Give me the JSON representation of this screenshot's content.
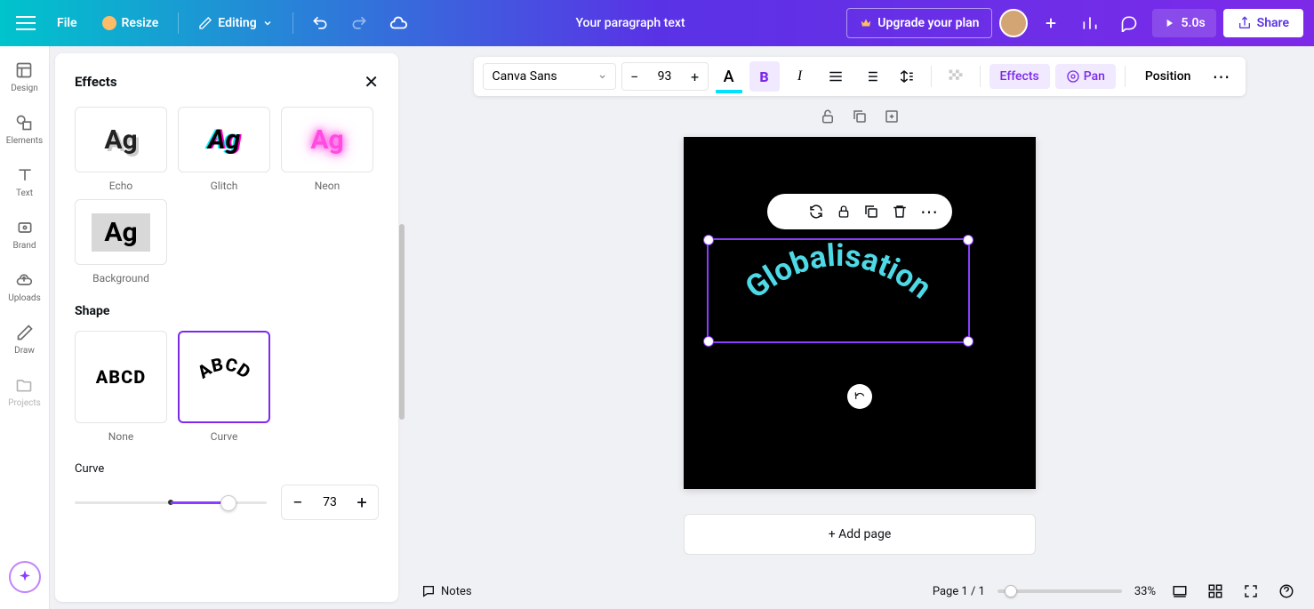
{
  "topbar": {
    "file": "File",
    "resize": "Resize",
    "editing": "Editing",
    "title": "Your paragraph text",
    "upgrade": "Upgrade your plan",
    "timer": "5.0s",
    "share": "Share"
  },
  "leftnav": {
    "items": [
      "Design",
      "Elements",
      "Text",
      "Brand",
      "Uploads",
      "Draw",
      "Projects"
    ]
  },
  "panel": {
    "title": "Effects",
    "styles": {
      "echo": "Echo",
      "glitch": "Glitch",
      "neon": "Neon",
      "background": "Background",
      "sample": "Ag"
    },
    "shape_title": "Shape",
    "shapes": {
      "none": "None",
      "curve": "Curve",
      "sample": "ABCD"
    },
    "curve_label": "Curve",
    "curve_value": "73"
  },
  "toolbar": {
    "font": "Canva Sans",
    "size": "93",
    "effects": "Effects",
    "pan": "Pan",
    "position": "Position"
  },
  "canvas": {
    "text": "Globalisation",
    "add_page": "+ Add page"
  },
  "bottombar": {
    "notes": "Notes",
    "page_indicator": "Page 1 / 1",
    "zoom": "33%"
  }
}
